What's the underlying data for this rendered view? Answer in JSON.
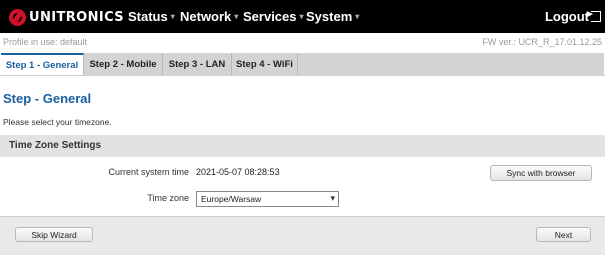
{
  "brand": {
    "name": "UNITRONICS"
  },
  "nav": {
    "items": [
      {
        "label": "Status"
      },
      {
        "label": "Network"
      },
      {
        "label": "Services"
      },
      {
        "label": "System"
      }
    ],
    "logout_label": "Logout"
  },
  "profile_text": "Profile in use: default",
  "fw_text": "FW ver.: UCR_R_17.01.12.25",
  "tabs": [
    {
      "label": "Step 1 - General",
      "active": true
    },
    {
      "label": "Step 2 - Mobile",
      "active": false
    },
    {
      "label": "Step 3 - LAN",
      "active": false
    },
    {
      "label": "Step 4 - WiFi",
      "active": false
    }
  ],
  "page": {
    "title": "Step - General",
    "hint": "Please select your timezone."
  },
  "section": {
    "title": "Time Zone Settings",
    "current_time_label": "Current system time",
    "current_time_value": "2021-05-07 08:28:53",
    "sync_button": "Sync with browser",
    "timezone_label": "Time zone",
    "timezone_value": "Europe/Warsaw"
  },
  "footer": {
    "skip_label": "Skip Wizard",
    "next_label": "Next"
  },
  "colors": {
    "accent": "#1a5fa0",
    "topbar": "#000000",
    "brand_red": "#d0112b"
  }
}
